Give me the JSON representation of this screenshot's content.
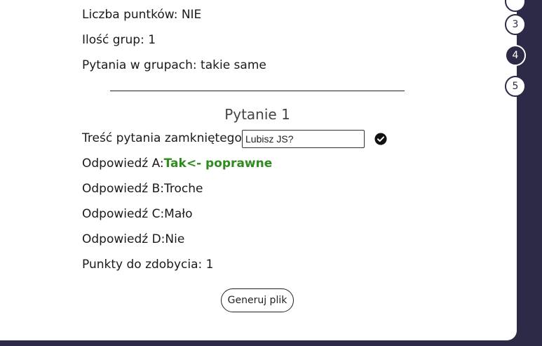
{
  "settings": {
    "points_line": "Liczba puntków: NIE",
    "groups_line": "Ilość grup: 1",
    "group_questions_line": "Pytania w grupach: takie same"
  },
  "question": {
    "title": "Pytanie 1",
    "content_label": "Treść pytania zamkniętego:",
    "content_value": "Lubisz JS?",
    "answer_a_label": "Odpowiedź A:",
    "answer_a_value": "Tak<- poprawne",
    "answer_b_line": "Odpowiedź B:Troche",
    "answer_c_line": "Odpowiedź C:Mało",
    "answer_d_line": "Odpowiedź D:Nie",
    "points_line": "Punkty do zdobycia: 1"
  },
  "actions": {
    "generate_label": "Generuj plik"
  },
  "steps": [
    {
      "label": "3",
      "active": false
    },
    {
      "label": "4",
      "active": true
    },
    {
      "label": "5",
      "active": false
    }
  ],
  "colors": {
    "accent_dark": "#2d2a47",
    "correct_green": "#2e8b1e"
  }
}
